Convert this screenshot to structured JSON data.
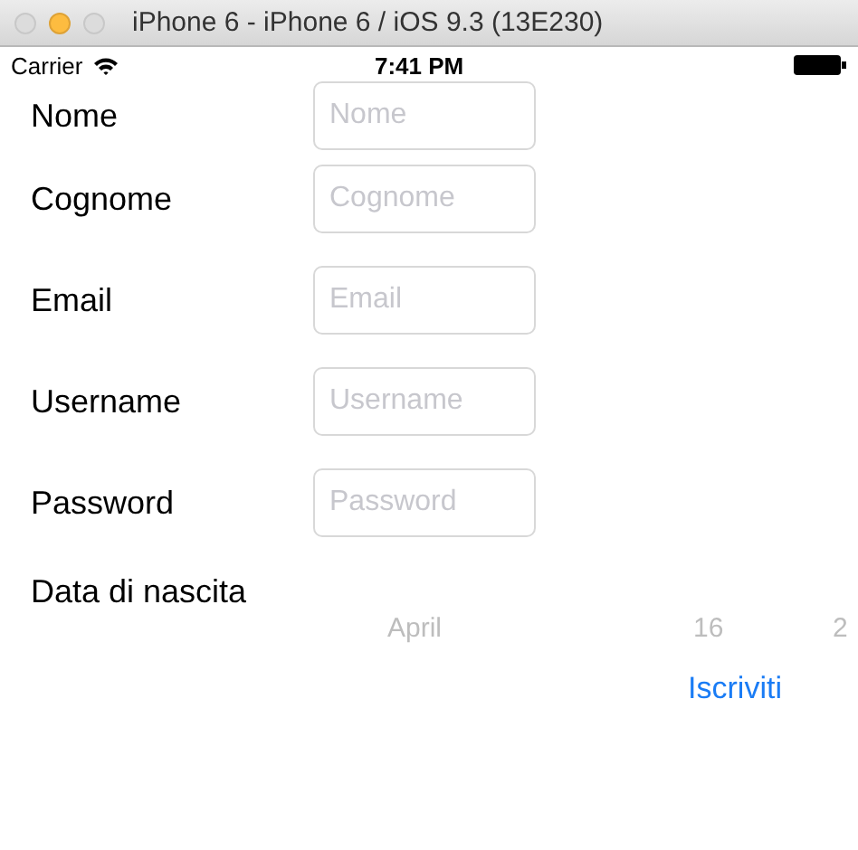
{
  "window": {
    "title": "iPhone 6 - iPhone 6 / iOS 9.3 (13E230)"
  },
  "status_bar": {
    "carrier": "Carrier",
    "time": "7:41 PM"
  },
  "form": {
    "fields": [
      {
        "label": "Nome",
        "placeholder": "Nome"
      },
      {
        "label": "Cognome",
        "placeholder": "Cognome"
      },
      {
        "label": "Email",
        "placeholder": "Email"
      },
      {
        "label": "Username",
        "placeholder": "Username"
      },
      {
        "label": "Password",
        "placeholder": "Password"
      }
    ],
    "birth_date": {
      "label": "Data di nascita",
      "picker": [
        "April",
        "16",
        "2"
      ]
    },
    "submit": "Iscriviti"
  }
}
